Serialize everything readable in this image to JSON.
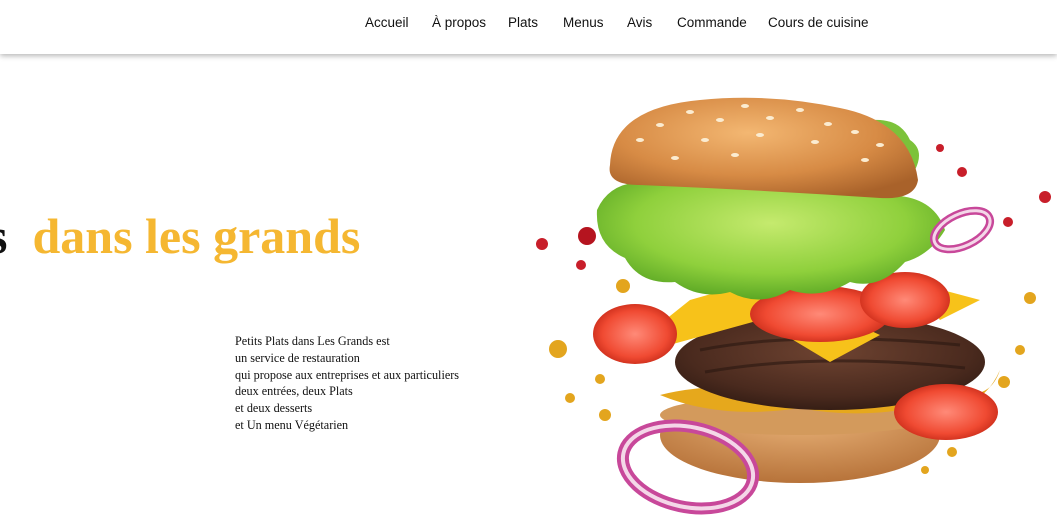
{
  "nav": {
    "items": [
      "Accueil",
      "À propos",
      "Plats",
      "Menus",
      "Avis",
      "Commande",
      "Cours de cuisine"
    ]
  },
  "hero": {
    "title_dark": "s",
    "title_accent": "dans les grands",
    "description": [
      "Petits Plats dans Les Grands est",
      "un service de restauration",
      "qui propose aux entreprises et aux particuliers",
      "deux entrées, deux Plats",
      "et deux desserts",
      "et Un menu Végétarien"
    ]
  },
  "colors": {
    "accent": "#f5b731",
    "text": "#111111",
    "background": "#ffffff"
  },
  "image": {
    "icon": "burger-illustration"
  }
}
